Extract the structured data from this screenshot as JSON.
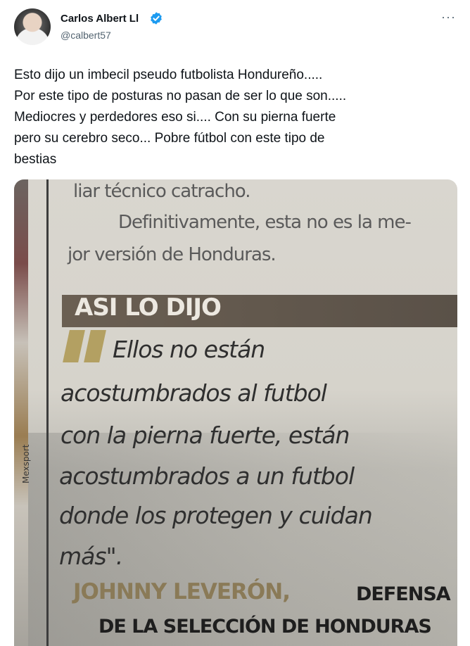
{
  "tweet": {
    "author_name": "Carlos Albert Ll",
    "handle": "@calbert57",
    "more_label": "···",
    "text_lines": [
      "Esto dijo un imbecil pseudo futbolista Hondureño.....",
      "Por este tipo de posturas no pasan de ser lo que son.....",
      "Mediocres y perdedores eso si.... Con su pierna fuerte",
      "pero su cerebro seco... Pobre fútbol con este tipo de",
      "bestias"
    ]
  },
  "photo": {
    "paragraph_lines": [
      "liar técnico catracho.",
      "Definitivamente, esta no es la me-",
      "jor versión de Honduras."
    ],
    "banner": "ASI LO DIJO",
    "quote_lines": [
      "Ellos no están",
      "acostumbrados al futbol",
      "con la pierna fuerte, están",
      "acostumbrados a un futbol",
      "donde los protegen y cuidan",
      "más\"."
    ],
    "author_name": "JOHNNY LEVERÓN,",
    "author_role_1": "DEFENSA",
    "author_role_2": "DE LA SELECCIÓN DE HONDURAS",
    "source_label": "Mexsport"
  },
  "colors": {
    "verified": "#1d9bf0",
    "banner_bg": "#615749",
    "quote_mark": "#b3a062",
    "author_name_color": "#8a7a57"
  }
}
